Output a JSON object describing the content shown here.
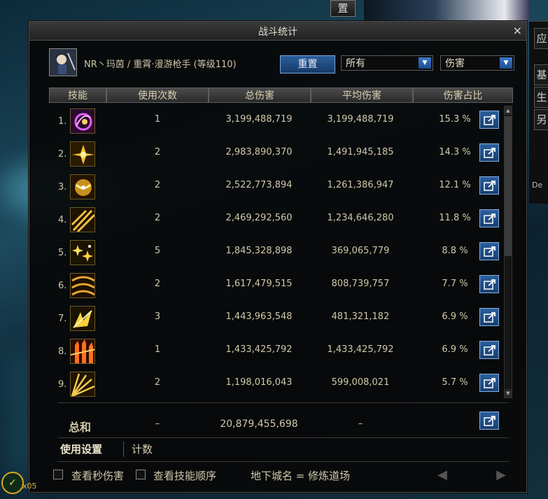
{
  "background": {
    "top_button": "置",
    "side_buttons": [
      "应",
      "基",
      "生",
      "另"
    ],
    "side_label": "De"
  },
  "window": {
    "title": "战斗统计",
    "close_glyph": "×"
  },
  "character": {
    "name": "NR丶玛茵 / 重霄·漫游枪手 (等级110)"
  },
  "controls": {
    "reset_label": "重置",
    "filter_value": "所有",
    "metric_value": "伤害",
    "dropdown_glyph": "▼"
  },
  "table": {
    "headers": [
      "技能",
      "使用次数",
      "总伤害",
      "平均伤害",
      "伤害占比"
    ],
    "rows": [
      {
        "rank": "1.",
        "uses": "1",
        "total": "3,199,488,719",
        "avg": "3,199,488,719",
        "pct": "15.3 %",
        "icon": "arcane-swirl-icon"
      },
      {
        "rank": "2.",
        "uses": "2",
        "total": "2,983,890,370",
        "avg": "1,491,945,185",
        "pct": "14.3 %",
        "icon": "golden-burst-icon"
      },
      {
        "rank": "3.",
        "uses": "2",
        "total": "2,522,773,894",
        "avg": "1,261,386,947",
        "pct": "12.1 %",
        "icon": "golden-orb-icon"
      },
      {
        "rank": "4.",
        "uses": "2",
        "total": "2,469,292,560",
        "avg": "1,234,646,280",
        "pct": "11.8 %",
        "icon": "golden-slash-icon"
      },
      {
        "rank": "5.",
        "uses": "5",
        "total": "1,845,328,898",
        "avg": "369,065,779",
        "pct": "8.8 %",
        "icon": "spark-stars-icon"
      },
      {
        "rank": "6.",
        "uses": "2",
        "total": "1,617,479,515",
        "avg": "808,739,757",
        "pct": "7.7 %",
        "icon": "golden-chain-icon"
      },
      {
        "rank": "7.",
        "uses": "3",
        "total": "1,443,963,548",
        "avg": "481,321,182",
        "pct": "6.9 %",
        "icon": "golden-wing-icon"
      },
      {
        "rank": "8.",
        "uses": "1",
        "total": "1,433,425,792",
        "avg": "1,433,425,792",
        "pct": "6.9 %",
        "icon": "flame-pillars-icon"
      },
      {
        "rank": "9.",
        "uses": "2",
        "total": "1,198,016,043",
        "avg": "599,008,021",
        "pct": "5.7 %",
        "icon": "light-rays-icon"
      }
    ],
    "total": {
      "label": "总和",
      "uses": "–",
      "total": "20,879,455,698",
      "avg": "–"
    }
  },
  "tabs": {
    "usage_settings": "使用设置",
    "count": "计数"
  },
  "footer": {
    "dps_label": "查看秒伤害",
    "order_label": "查看技能顺序",
    "dungeon_text": "地下城名 = 修炼道场",
    "prev_glyph": "◀",
    "next_glyph": "▶"
  },
  "corner": {
    "glyph": "✓",
    "count": "x05"
  }
}
